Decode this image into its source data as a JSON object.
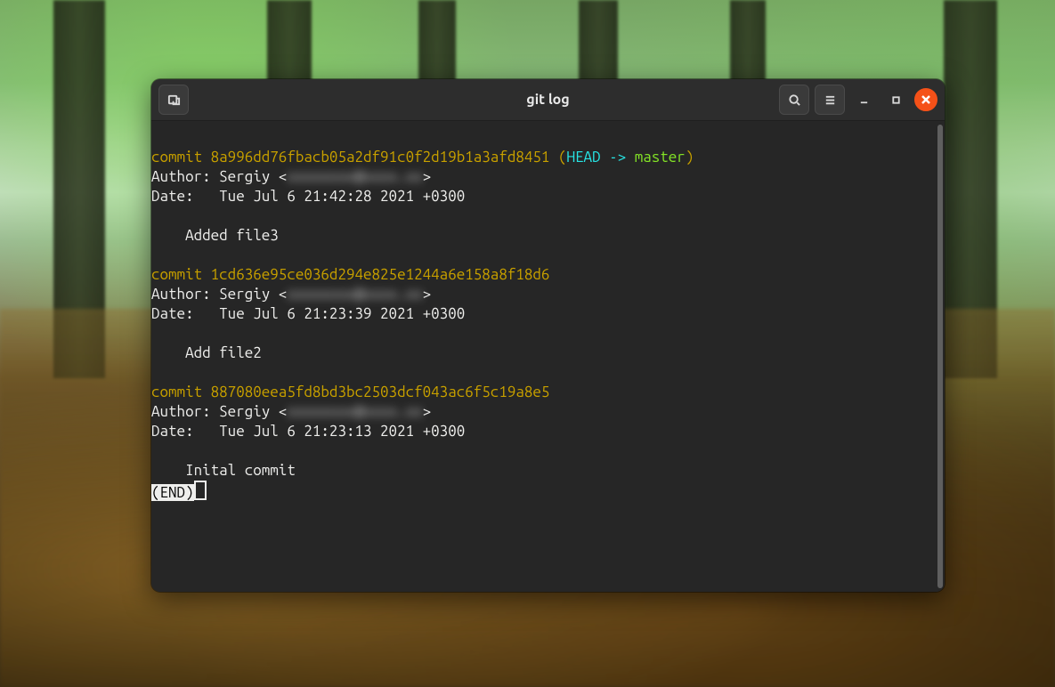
{
  "window": {
    "title": "git log"
  },
  "log": {
    "commits": [
      {
        "hash": "8a996dd76fbacb05a2df91c0f2d19b1a3afd8451",
        "refs": {
          "head": "HEAD",
          "arrow": "->",
          "branch": "master"
        },
        "author_name": "Sergiy",
        "author_email_masked": "xxxxxxxx@xxxx.xx",
        "date": "Tue Jul 6 21:42:28 2021 +0300",
        "message": "Added file3"
      },
      {
        "hash": "1cd636e95ce036d294e825e1244a6e158a8f18d6",
        "refs": null,
        "author_name": "Sergiy",
        "author_email_masked": "xxxxxxxx@xxxx.xx",
        "date": "Tue Jul 6 21:23:39 2021 +0300",
        "message": "Add file2"
      },
      {
        "hash": "887080eea5fd8bd3bc2503dcf043ac6f5c19a8e5",
        "refs": null,
        "author_name": "Sergiy",
        "author_email_masked": "xxxxxxxx@xxxx.xx",
        "date": "Tue Jul 6 21:23:13 2021 +0300",
        "message": "Inital commit"
      }
    ],
    "pager_end": "(END)"
  },
  "labels": {
    "commit": "commit",
    "author": "Author:",
    "date": "Date:"
  }
}
